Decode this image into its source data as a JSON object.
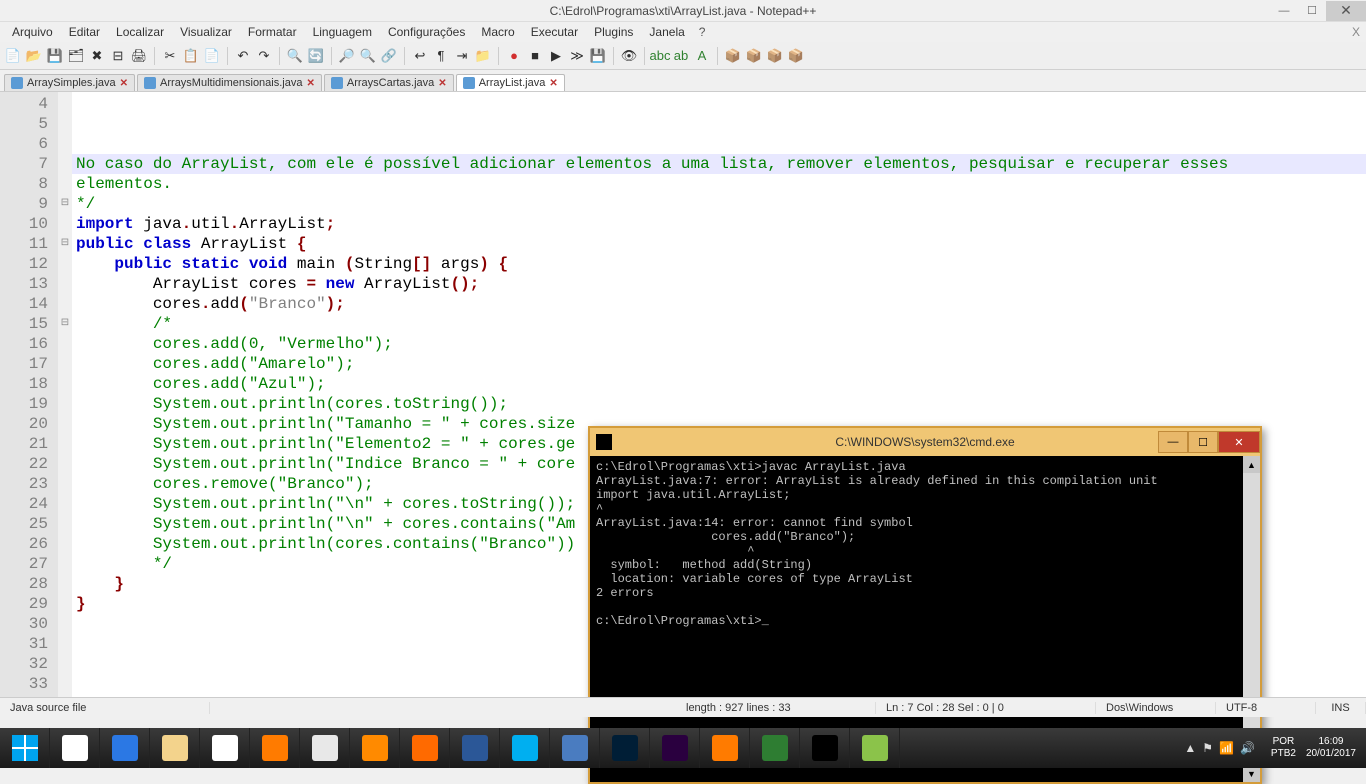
{
  "title": "C:\\Edrol\\Programas\\xti\\ArrayList.java - Notepad++",
  "menu": [
    "Arquivo",
    "Editar",
    "Localizar",
    "Visualizar",
    "Formatar",
    "Linguagem",
    "Configurações",
    "Macro",
    "Executar",
    "Plugins",
    "Janela",
    "?"
  ],
  "tabs": [
    {
      "label": "ArraySimples.java",
      "active": false
    },
    {
      "label": "ArraysMultidimensionais.java",
      "active": false
    },
    {
      "label": "ArraysCartas.java",
      "active": false
    },
    {
      "label": "ArrayList.java",
      "active": true
    }
  ],
  "line_start": 4,
  "line_end": 33,
  "highlight_line": 7,
  "fold": {
    "9": "⊟",
    "11": "⊟",
    "15": "⊟"
  },
  "code": {
    "4": [
      {
        "t": "No caso do ArrayList, com ele é possível adicionar elementos a uma lista, remover elementos, pesquisar e recuperar esses ",
        "c": "com"
      }
    ],
    "5": [
      {
        "t": "elementos.",
        "c": "com"
      }
    ],
    "6": [
      {
        "t": "*/",
        "c": "com"
      }
    ],
    "7": [
      {
        "t": "import ",
        "c": "kw"
      },
      {
        "t": "java"
      },
      {
        "t": ".",
        "c": "op"
      },
      {
        "t": "util"
      },
      {
        "t": ".",
        "c": "op"
      },
      {
        "t": "ArrayList"
      },
      {
        "t": ";",
        "c": "op"
      }
    ],
    "8": [
      {
        "t": ""
      }
    ],
    "9": [
      {
        "t": "public class ",
        "c": "kw"
      },
      {
        "t": "ArrayList "
      },
      {
        "t": "{",
        "c": "br"
      }
    ],
    "10": [
      {
        "t": ""
      }
    ],
    "11": [
      {
        "t": "    "
      },
      {
        "t": "public static void ",
        "c": "kw"
      },
      {
        "t": "main "
      },
      {
        "t": "(",
        "c": "op"
      },
      {
        "t": "String"
      },
      {
        "t": "[] ",
        "c": "op"
      },
      {
        "t": "args"
      },
      {
        "t": ") {",
        "c": "op"
      }
    ],
    "12": [
      {
        "t": ""
      }
    ],
    "13": [
      {
        "t": "        ArrayList cores "
      },
      {
        "t": "= ",
        "c": "op"
      },
      {
        "t": "new ",
        "c": "kw"
      },
      {
        "t": "ArrayList"
      },
      {
        "t": "();",
        "c": "op"
      }
    ],
    "14": [
      {
        "t": "        cores"
      },
      {
        "t": ".",
        "c": "op"
      },
      {
        "t": "add"
      },
      {
        "t": "(",
        "c": "op"
      },
      {
        "t": "\"Branco\"",
        "c": "str"
      },
      {
        "t": ");",
        "c": "op"
      }
    ],
    "15": [
      {
        "t": "        "
      },
      {
        "t": "/*",
        "c": "com"
      }
    ],
    "16": [
      {
        "t": "        cores.add(0, \"Vermelho\");",
        "c": "com"
      }
    ],
    "17": [
      {
        "t": "        cores.add(\"Amarelo\");",
        "c": "com"
      }
    ],
    "18": [
      {
        "t": "        cores.add(\"Azul\");",
        "c": "com"
      }
    ],
    "19": [
      {
        "t": "",
        "c": "com"
      }
    ],
    "20": [
      {
        "t": "        System.out.println(cores.toString());",
        "c": "com"
      }
    ],
    "21": [
      {
        "t": "",
        "c": "com"
      }
    ],
    "22": [
      {
        "t": "        System.out.println(\"Tamanho = \" + cores.size",
        "c": "com"
      }
    ],
    "23": [
      {
        "t": "        System.out.println(\"Elemento2 = \" + cores.ge",
        "c": "com"
      }
    ],
    "24": [
      {
        "t": "        System.out.println(\"Indice Branco = \" + core",
        "c": "com"
      }
    ],
    "25": [
      {
        "t": "",
        "c": "com"
      }
    ],
    "26": [
      {
        "t": "        cores.remove(\"Branco\");",
        "c": "com"
      }
    ],
    "27": [
      {
        "t": "        System.out.println(\"\\n\" + cores.toString());",
        "c": "com"
      }
    ],
    "28": [
      {
        "t": "",
        "c": "com"
      }
    ],
    "29": [
      {
        "t": "        System.out.println(\"\\n\" + cores.contains(\"Am",
        "c": "com"
      }
    ],
    "30": [
      {
        "t": "        System.out.println(cores.contains(\"Branco\"))",
        "c": "com"
      }
    ],
    "31": [
      {
        "t": "        */",
        "c": "com"
      }
    ],
    "32": [
      {
        "t": "    "
      },
      {
        "t": "}",
        "c": "br"
      }
    ],
    "33": [
      {
        "t": "}",
        "c": "br"
      }
    ]
  },
  "cmd": {
    "title": "C:\\WINDOWS\\system32\\cmd.exe",
    "lines": [
      "c:\\Edrol\\Programas\\xti>javac ArrayList.java",
      "ArrayList.java:7: error: ArrayList is already defined in this compilation unit",
      "import java.util.ArrayList;",
      "^",
      "ArrayList.java:14: error: cannot find symbol",
      "                cores.add(\"Branco\");",
      "                     ^",
      "  symbol:   method add(String)",
      "  location: variable cores of type ArrayList",
      "2 errors",
      "",
      "c:\\Edrol\\Programas\\xti>_"
    ]
  },
  "status": {
    "left": "Java source file",
    "center": "length : 927    lines : 33",
    "pos": "Ln : 7    Col : 28    Sel : 0 | 0",
    "enc1": "Dos\\Windows",
    "enc2": "UTF-8",
    "ins": "INS"
  },
  "tray": {
    "lang1": "POR",
    "lang2": "PTB2",
    "time": "16:09",
    "date": "20/01/2017"
  },
  "task_icons": [
    {
      "bg": "#ffffff"
    },
    {
      "bg": "#2b78e4"
    },
    {
      "bg": "#f3d38c"
    },
    {
      "bg": "#fff"
    },
    {
      "bg": "#ff7b00"
    },
    {
      "bg": "#e8e8e8"
    },
    {
      "bg": "#ff8a00"
    },
    {
      "bg": "#ff6a00"
    },
    {
      "bg": "#2b5797"
    },
    {
      "bg": "#00aff0"
    },
    {
      "bg": "#4a7cc0"
    },
    {
      "bg": "#001e36"
    },
    {
      "bg": "#2a003f"
    },
    {
      "bg": "#ff7b00"
    },
    {
      "bg": "#2e7d32"
    },
    {
      "bg": "#000"
    },
    {
      "bg": "#8bc34a"
    }
  ]
}
